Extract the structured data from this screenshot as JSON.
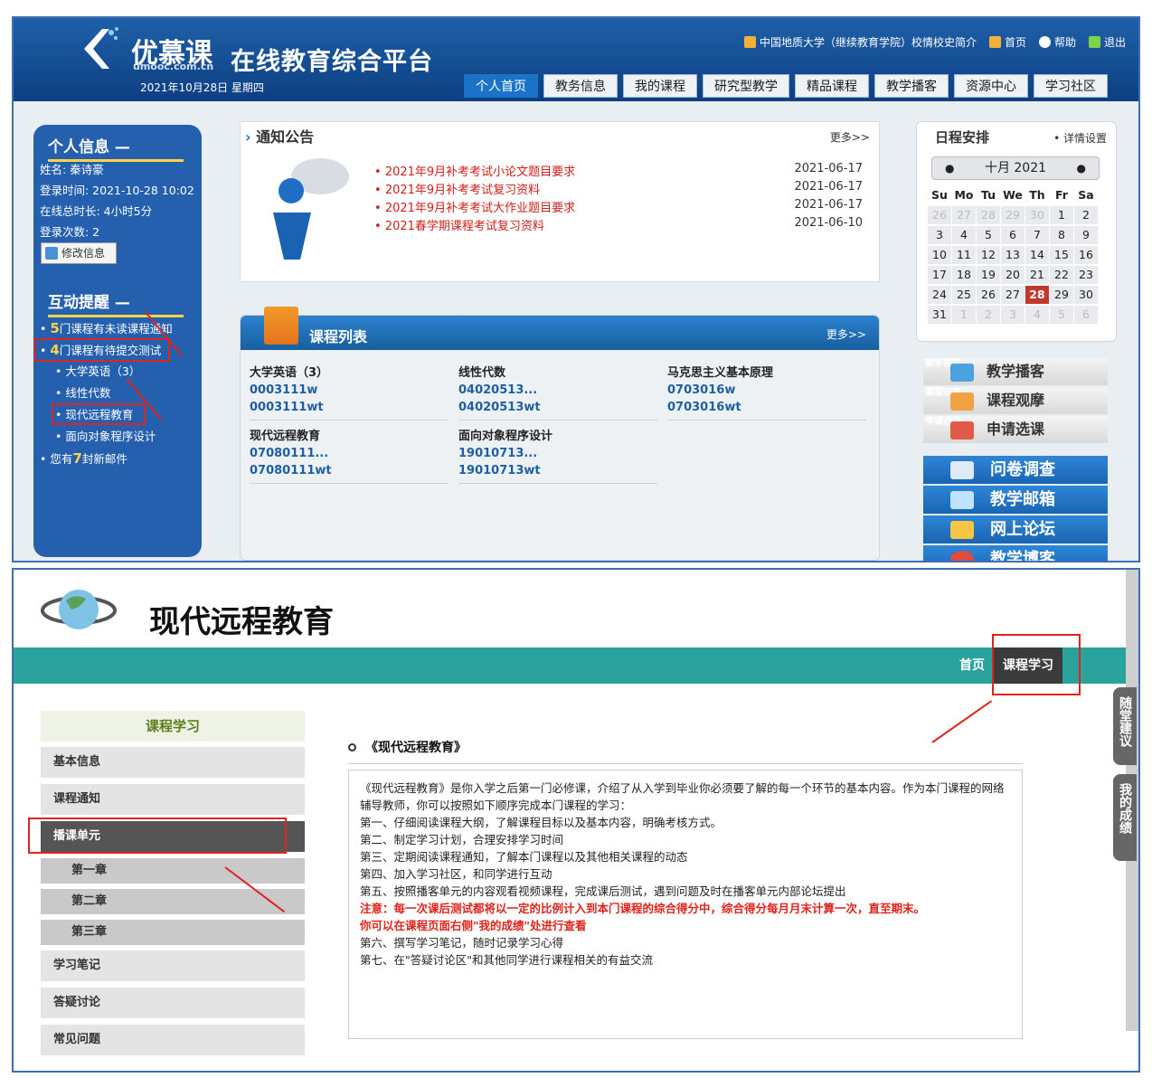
{
  "portal": {
    "brand": "优慕课",
    "brand_domain": "umooc.com.cn",
    "platform_title": "在线教育综合平台",
    "date": "2021年10月28日 星期四",
    "top_links": [
      "中国地质大学（继续教育学院）校情校史简介",
      "首页",
      "帮助",
      "退出"
    ],
    "tabs": [
      "个人首页",
      "教务信息",
      "我的课程",
      "研究型教学",
      "精品课程",
      "教学播客",
      "资源中心",
      "学习社区"
    ],
    "personal": {
      "title": "个人信息",
      "name": "姓名: 秦诗豪",
      "login_time": "登录时间:   2021-10-28 10:02",
      "online": "在线总时长:   4小时5分",
      "login_count": "登录次数:   2",
      "edit": "修改信息"
    },
    "interact": {
      "title": "互动提醒",
      "unread_n": "5",
      "unread_t": "门课程有未读课程通知",
      "pending_n": "4",
      "pending_t": "门课程有待提交测试",
      "courses": [
        "大学英语（3）",
        "线性代数",
        "现代远程教育",
        "面向对象程序设计"
      ],
      "mail_pre": "您有",
      "mail_n": "7",
      "mail_post": "封新邮件"
    },
    "notice": {
      "title": "通知公告",
      "more": "更多>>",
      "items": [
        {
          "t": "2021年9月补考考试小论文题目要求",
          "d": "2021-06-17"
        },
        {
          "t": "2021年9月补考考试复习资料",
          "d": "2021-06-17"
        },
        {
          "t": "2021年9月补考考试大作业题目要求",
          "d": "2021-06-17"
        },
        {
          "t": "2021春学期课程考试复习资料",
          "d": "2021-06-10"
        }
      ]
    },
    "courses": {
      "title": "课程列表",
      "more": "更多>>",
      "items": [
        {
          "n": "大学英语（3）",
          "c1": "0003111w",
          "c2": "0003111wt"
        },
        {
          "n": "线性代数",
          "c1": "04020513...",
          "c2": "04020513wt"
        },
        {
          "n": "马克思主义基本原理",
          "c1": "0703016w",
          "c2": "0703016wt"
        },
        {
          "n": "现代远程教育",
          "c1": "07080111...",
          "c2": "07080111wt"
        },
        {
          "n": "面向对象程序设计",
          "c1": "19010713...",
          "c2": "19010713wt"
        }
      ]
    },
    "schedule": {
      "title": "日程安排",
      "detail": "• 详情设置",
      "month": "十月 2021",
      "weekdays": [
        "Su",
        "Mo",
        "Tu",
        "We",
        "Th",
        "Fr",
        "Sa"
      ],
      "days": [
        "26",
        "27",
        "28",
        "29",
        "30",
        "1",
        "2",
        "3",
        "4",
        "5",
        "6",
        "7",
        "8",
        "9",
        "10",
        "11",
        "12",
        "13",
        "14",
        "15",
        "16",
        "17",
        "18",
        "19",
        "20",
        "21",
        "22",
        "23",
        "24",
        "25",
        "26",
        "27",
        "28",
        "29",
        "30",
        "31",
        "1",
        "2",
        "3",
        "4",
        "5",
        "6"
      ]
    },
    "side_links": [
      "教学播客",
      "课程观摩",
      "申请选课"
    ],
    "side_links_faint": [
      "教学播客",
      "课程观摩",
      "申请选课"
    ],
    "blue_links": [
      "问卷调查",
      "教学邮箱",
      "网上论坛",
      "教学博客"
    ]
  },
  "course_page": {
    "title": "现代远程教育",
    "nav": [
      "首页",
      "课程学习"
    ],
    "side_header": "课程学习",
    "menu": [
      "基本信息",
      "课程通知",
      "播课单元"
    ],
    "chapters": [
      "第一章",
      "第二章",
      "第三章"
    ],
    "menu_after": [
      "学习笔记",
      "答疑讨论",
      "常见问题"
    ],
    "content_title": "《现代远程教育》",
    "content_lines": [
      "《现代远程教育》是你入学之后第一门必修课，介绍了从入学到毕业你必须要了解的每一个环节的基本内容。作为本门课程的网络辅导教师，你可以按照如下顺序完成本门课程的学习：",
      "第一、仔细阅读课程大纲，了解课程目标以及基本内容，明确考核方式。",
      "第二、制定学习计划，合理安排学习时间",
      "第三、定期阅读课程通知，了解本门课程以及其他相关课程的动态",
      "第四、加入学习社区，和同学进行互动",
      "第五、按照播客单元的内容观看视频课程，完成课后测试，遇到问题及时在播客单元内部论坛提出"
    ],
    "content_red": [
      "注意：每一次课后测试都将以一定的比例计入到本门课程的综合得分中，综合得分每月月末计算一次，直至期末。",
      "你可以在课程页面右侧\"我的成绩\"处进行查看"
    ],
    "content_tail": [
      "第六、撰写学习笔记，随时记录学习心得",
      "第七、在\"答疑讨论区\"和其他同学进行课程相关的有益交流"
    ],
    "vtabs": [
      "随堂建议",
      "我的成绩"
    ]
  },
  "colors": {
    "accent_red": "#e0231c",
    "teal": "#2aa39c",
    "portal_blue": "#1f60a8"
  }
}
